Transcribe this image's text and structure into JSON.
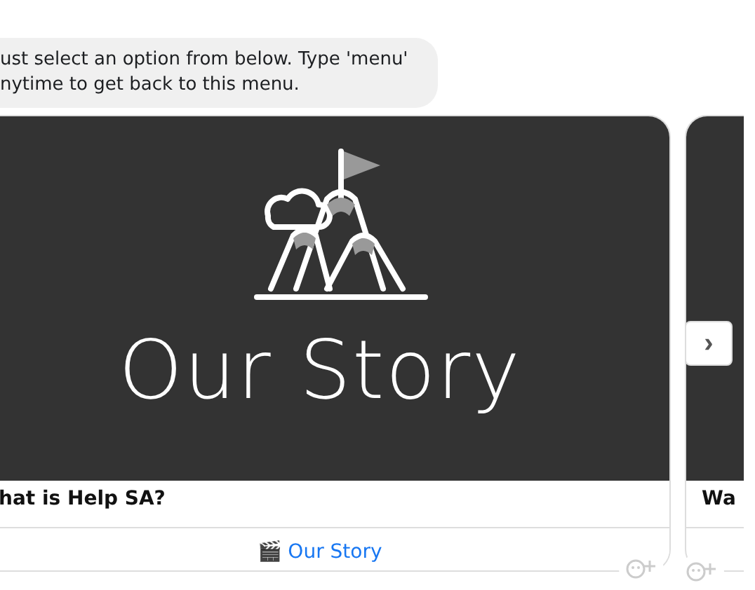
{
  "message": {
    "lines": [
      "ust select an option from below. Type 'menu'",
      "nytime to get back to this menu."
    ]
  },
  "cards": [
    {
      "image_text": "Our Story",
      "title": "hat is Help SA?",
      "button": {
        "icon": "🎬",
        "label": "Our Story"
      }
    },
    {
      "title": "Wa"
    }
  ],
  "next_button": {
    "label": "›"
  }
}
